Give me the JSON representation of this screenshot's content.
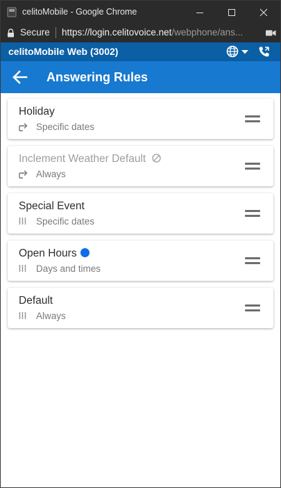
{
  "browser": {
    "window_title": "celitoMobile - Google Chrome",
    "secure_label": "Secure",
    "url_host": "https://login.celitovoice.net",
    "url_path": "/webphone/ans..."
  },
  "app": {
    "title": "celitoMobile Web (3002)",
    "page_title": "Answering Rules"
  },
  "rules": [
    {
      "name": "Holiday",
      "schedule": "Specific dates",
      "icon": "forward-icon",
      "status": "enabled"
    },
    {
      "name": "Inclement Weather Default",
      "schedule": "Always",
      "icon": "forward-icon",
      "status": "disabled"
    },
    {
      "name": "Special Event",
      "schedule": "Specific dates",
      "icon": "ring-group-icon",
      "status": "enabled"
    },
    {
      "name": "Open Hours",
      "schedule": "Days and times",
      "icon": "ring-group-icon",
      "status": "active"
    },
    {
      "name": "Default",
      "schedule": "Always",
      "icon": "ring-group-icon",
      "status": "enabled"
    }
  ],
  "colors": {
    "app_bar": "#0b5fa5",
    "toolbar": "#1779cf",
    "active_dot": "#0d6ee6"
  }
}
